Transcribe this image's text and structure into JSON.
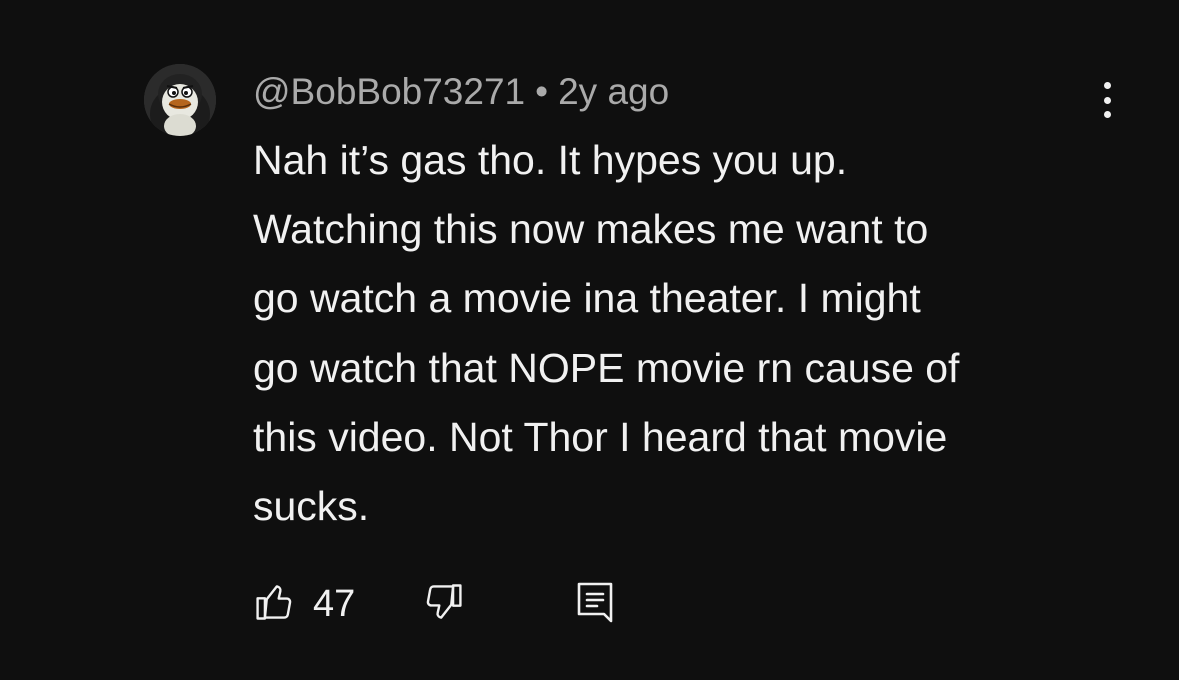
{
  "comment": {
    "author": "@BobBob73271",
    "separator": "•",
    "time": "2y ago",
    "text": "Nah it’s gas tho. It hypes you up.\nWatching this now makes me want to\ngo watch a movie ina theater. I might\ngo watch that NOPE movie rn cause of\nthis video. Not Thor I heard that movie\nsucks.",
    "like_count": "47",
    "icons": {
      "avatar": "penguin-avatar",
      "menu": "more-vertical-icon",
      "like": "thumbs-up-icon",
      "dislike": "thumbs-down-icon",
      "reply": "reply-comment-icon"
    }
  },
  "colors": {
    "background": "#0f0f0f",
    "primary_text": "#f1f1f1",
    "secondary_text": "#aaaaaa"
  }
}
